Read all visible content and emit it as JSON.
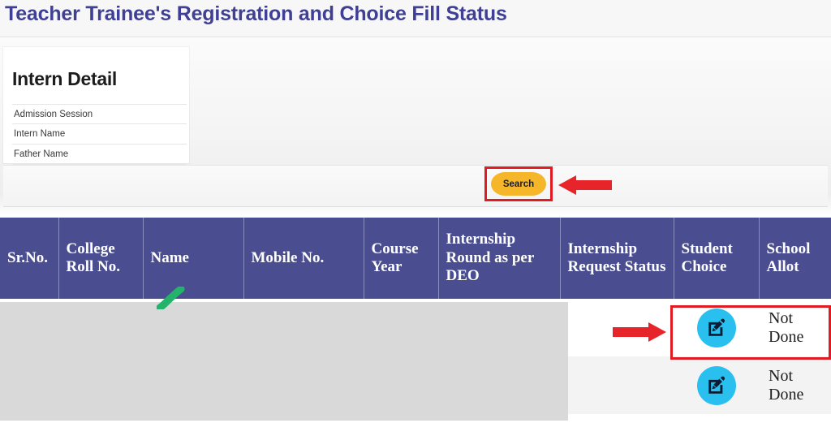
{
  "page": {
    "title": "Teacher Trainee's Registration and Choice Fill Status",
    "title_color": "#3f4095"
  },
  "intern_detail": {
    "heading": "Intern Detail",
    "fields": [
      {
        "label": "Admission Session",
        "value": ""
      },
      {
        "label": "Intern Name",
        "value": ""
      },
      {
        "label": "Father Name",
        "value": ""
      }
    ]
  },
  "search": {
    "button_label": "Search",
    "button_color": "#f5b62a"
  },
  "annotations": {
    "search_box_color": "#e01b22",
    "arrow_left_name": "red-arrow-left",
    "arrow_right_name": "red-arrow-right",
    "green_mark_color": "#22b573",
    "row_box_color": "#e01b22"
  },
  "table": {
    "header_bg": "#4a4e90",
    "columns": [
      "Sr.No.",
      "College Roll No.",
      "Name",
      "Mobile No.",
      "Course Year",
      "Internship Round as per DEO",
      "Internship Request Status",
      "Student Choice",
      "School Allot"
    ],
    "rows": [
      {
        "sr_no": "",
        "college_roll_no": "",
        "name": "",
        "mobile_no": "",
        "course_year": "",
        "internship_round": "",
        "internship_request_status": "",
        "student_choice_icon": "edit-pencil-square-icon",
        "school_allot": "Not Done"
      },
      {
        "sr_no": "",
        "college_roll_no": "",
        "name": "",
        "mobile_no": "",
        "course_year": "",
        "internship_round": "",
        "internship_request_status": "",
        "student_choice_icon": "edit-pencil-square-icon",
        "school_allot": "Not Done"
      }
    ]
  }
}
